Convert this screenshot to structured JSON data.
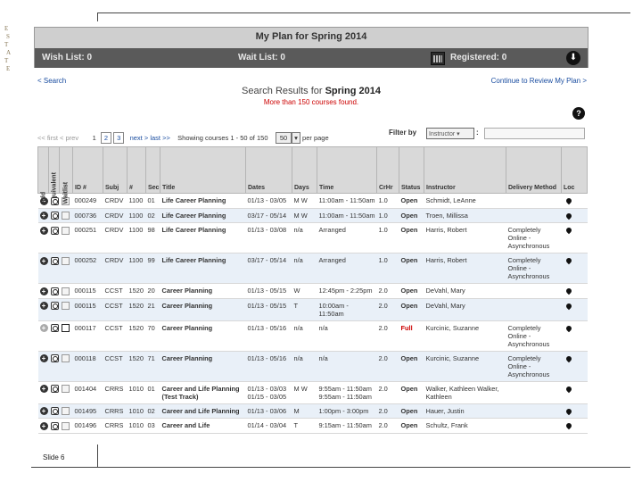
{
  "slide": {
    "number_label": "Slide 6",
    "seal_lines": [
      "E",
      "S",
      "T",
      "A",
      "T",
      "E"
    ]
  },
  "plan": {
    "title": "My Plan for Spring 2014",
    "wish_list": "Wish List: 0",
    "wait_list": "Wait List: 0",
    "registered": "Registered: 0",
    "download_glyph": "⬇"
  },
  "nav": {
    "back": "< Search",
    "continue": "Continue to Review My Plan >"
  },
  "results": {
    "title_prefix": "Search Results for ",
    "term": "Spring 2014",
    "warning": "More than 150 courses found."
  },
  "help_glyph": "?",
  "pager": {
    "first": "<< first",
    "prev": "< prev",
    "pages": [
      "1",
      "2",
      "3"
    ],
    "next": "next >",
    "last": "last >>",
    "showing": "Showing courses 1 - 50 of 150",
    "per_page_value": "50",
    "per_page_label": "per page"
  },
  "filter": {
    "label": "Filter by",
    "value": "Instructor",
    "colon": ":"
  },
  "columns": {
    "add": "Add",
    "equivalent": "Equivalent",
    "waitlist": "Waitlist",
    "id": "ID #",
    "subj": "Subj",
    "num": "#",
    "sec": "Sec",
    "title": "Title",
    "dates": "Dates",
    "days": "Days",
    "time": "Time",
    "crhr": "CrHr",
    "status": "Status",
    "instructor": "Instructor",
    "delivery": "Delivery Method",
    "loc": "Loc"
  },
  "rows": [
    {
      "id": "000249",
      "subj": "CRDV",
      "num": "1100",
      "sec": "01",
      "title": "Life Career Planning",
      "dates": "01/13 - 03/05",
      "days": "M W",
      "time": "11:00am - 11:50am",
      "crhr": "1.0",
      "status": "Open",
      "instructor": "Schmidt, LeAnne",
      "delivery": ""
    },
    {
      "id": "000736",
      "subj": "CRDV",
      "num": "1100",
      "sec": "02",
      "title": "Life Career Planning",
      "dates": "03/17 - 05/14",
      "days": "M W",
      "time": "11:00am - 11:50am",
      "crhr": "1.0",
      "status": "Open",
      "instructor": "Troen, Millissa",
      "delivery": ""
    },
    {
      "id": "000251",
      "subj": "CRDV",
      "num": "1100",
      "sec": "98",
      "title": "Life Career Planning",
      "dates": "01/13 - 03/08",
      "days": "n/a",
      "time": "Arranged",
      "crhr": "1.0",
      "status": "Open",
      "instructor": "Harris, Robert",
      "delivery": "Completely Online - Asynchronous"
    },
    {
      "id": "000252",
      "subj": "CRDV",
      "num": "1100",
      "sec": "99",
      "title": "Life Career Planning",
      "dates": "03/17 - 05/14",
      "days": "n/a",
      "time": "Arranged",
      "crhr": "1.0",
      "status": "Open",
      "instructor": "Harris, Robert",
      "delivery": "Completely Online - Asynchronous"
    },
    {
      "id": "000115",
      "subj": "CCST",
      "num": "1520",
      "sec": "20",
      "title": "Career Planning",
      "dates": "01/13 - 05/15",
      "days": "W",
      "time": "12:45pm - 2:25pm",
      "crhr": "2.0",
      "status": "Open",
      "instructor": "DeVahl, Mary",
      "delivery": ""
    },
    {
      "id": "000115",
      "subj": "CCST",
      "num": "1520",
      "sec": "21",
      "title": "Career Planning",
      "dates": "01/13 - 05/15",
      "days": "T",
      "time": "10:00am - 11:50am",
      "crhr": "2.0",
      "status": "Open",
      "instructor": "DeVahl, Mary",
      "delivery": ""
    },
    {
      "id": "000117",
      "subj": "CCST",
      "num": "1520",
      "sec": "70",
      "title": "Career Planning",
      "dates": "01/13 - 05/16",
      "days": "n/a",
      "time": "n/a",
      "crhr": "2.0",
      "status": "Full",
      "instructor": "Kurcinic, Suzanne",
      "delivery": "Completely Online - Asynchronous"
    },
    {
      "id": "000118",
      "subj": "CCST",
      "num": "1520",
      "sec": "71",
      "title": "Career Planning",
      "dates": "01/13 - 05/16",
      "days": "n/a",
      "time": "n/a",
      "crhr": "2.0",
      "status": "Open",
      "instructor": "Kurcinic, Suzanne",
      "delivery": "Completely Online - Asynchronous"
    },
    {
      "id": "001404",
      "subj": "CRRS",
      "num": "1010",
      "sec": "01",
      "title": "Career and Life Planning (Test Track)",
      "dates": "01/13 - 03/03  01/15 - 03/05",
      "days": "M  W",
      "time": "9:55am - 11:50am  9:55am - 11:50am",
      "crhr": "2.0",
      "status": "Open",
      "instructor": "Walker, Kathleen  Walker, Kathleen",
      "delivery": ""
    },
    {
      "id": "001495",
      "subj": "CRRS",
      "num": "1010",
      "sec": "02",
      "title": "Career and Life Planning",
      "dates": "01/13 - 03/06",
      "days": "M",
      "time": "1:00pm - 3:00pm",
      "crhr": "2.0",
      "status": "Open",
      "instructor": "Hauer, Justin",
      "delivery": ""
    },
    {
      "id": "001496",
      "subj": "CRRS",
      "num": "1010",
      "sec": "03",
      "title": "Career and Life",
      "dates": "01/14 - 03/04",
      "days": "T",
      "time": "9:15am - 11:50am",
      "crhr": "2.0",
      "status": "Open",
      "instructor": "Schultz, Frank",
      "delivery": ""
    }
  ]
}
